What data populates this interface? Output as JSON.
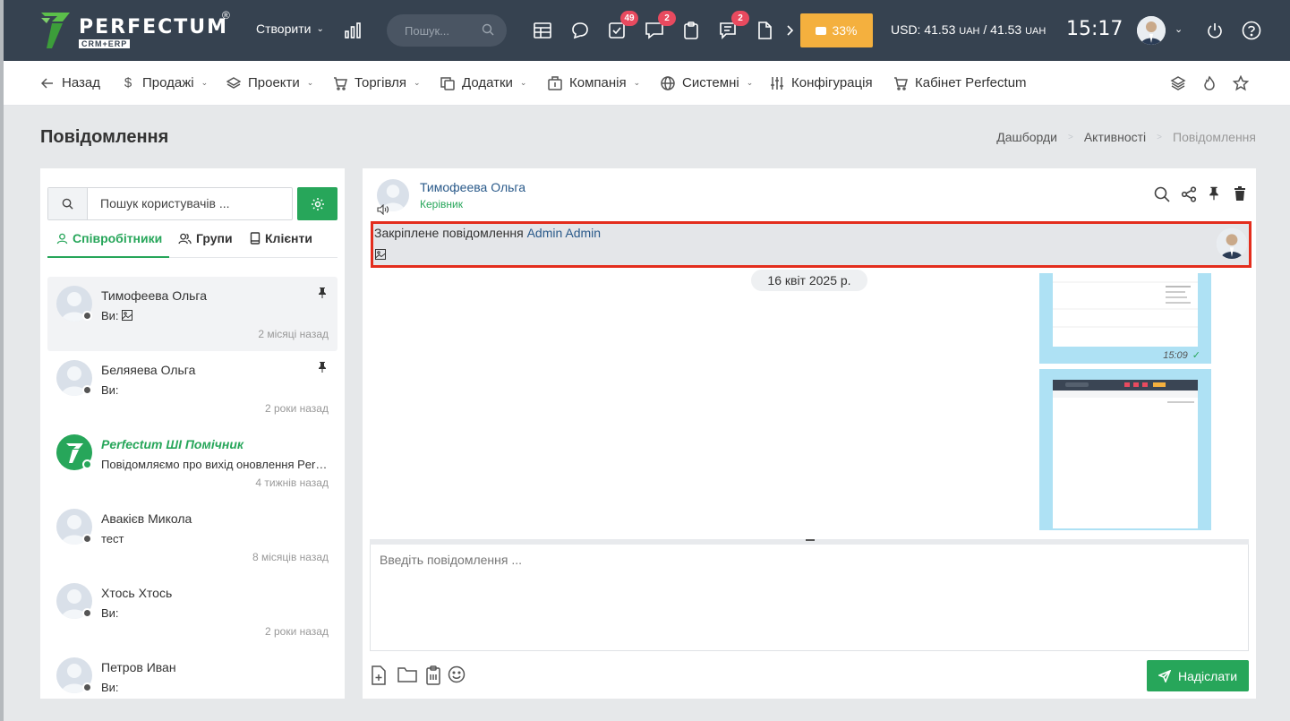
{
  "header": {
    "logo_text": "PERFECTUM",
    "logo_reg": "®",
    "logo_sub": "CRM+ERP",
    "create_label": "Створити",
    "search_placeholder": "Пошук...",
    "badges": {
      "tasks": "49",
      "chat": "2",
      "discussions": "2"
    },
    "progress_label": "33%",
    "progress_value": 0.33,
    "currency_prefix": "USD: 41.53",
    "currency_unit1": "UAH",
    "currency_sep": " / 41.53",
    "currency_unit2": "UAH",
    "clock": "15:17"
  },
  "nav": {
    "back": "Назад",
    "sales": "Продажі",
    "projects": "Проекти",
    "trade": "Торгівля",
    "addons": "Додатки",
    "company": "Компанія",
    "system": "Системні",
    "config": "Конфігурація",
    "cabinet": "Кабінет Perfectum"
  },
  "page": {
    "title": "Повідомлення",
    "breadcrumb": [
      "Дашборди",
      "Активності",
      "Повідомлення"
    ]
  },
  "sidebar": {
    "search_placeholder": "Пошук користувачів ...",
    "tabs": [
      "Співробітники",
      "Групи",
      "Клієнти"
    ],
    "contacts": [
      {
        "name": "Тимофеева Ольга",
        "msg": "Ви:",
        "time": "2 місяці назад"
      },
      {
        "name": "Беляяева Ольга",
        "msg": "Ви:",
        "time": "2 роки назад"
      },
      {
        "name": "Perfectum ШІ Помічник",
        "msg": "Повідомляємо про вихід оновлення Perfectum",
        "time": "4 тижнів назад"
      },
      {
        "name": "Авакієв Микола",
        "msg": "тест",
        "time": "8 місяців назад"
      },
      {
        "name": "Хтось Хтось",
        "msg": "Ви:",
        "time": "2 роки назад"
      },
      {
        "name": "Петров Иван",
        "msg": "Ви:",
        "time": ""
      }
    ]
  },
  "chat": {
    "name": "Тимофеева Ольга",
    "role": "Керівник",
    "pinned_label": "Закріплене повідомлення",
    "pinned_author": "Admin Admin",
    "date": "16 квіт 2025 р.",
    "msg_time": "15:09",
    "input_placeholder": "Введіть повідомлення ...",
    "send_label": "Надіслати"
  },
  "colors": {
    "topbar": "#364250",
    "accent_green": "#27a65a",
    "badge_red": "#e84a5f",
    "progress_orange": "#f4b03e",
    "highlight_red": "#e32d1d",
    "image_bg": "#aee1f4"
  }
}
